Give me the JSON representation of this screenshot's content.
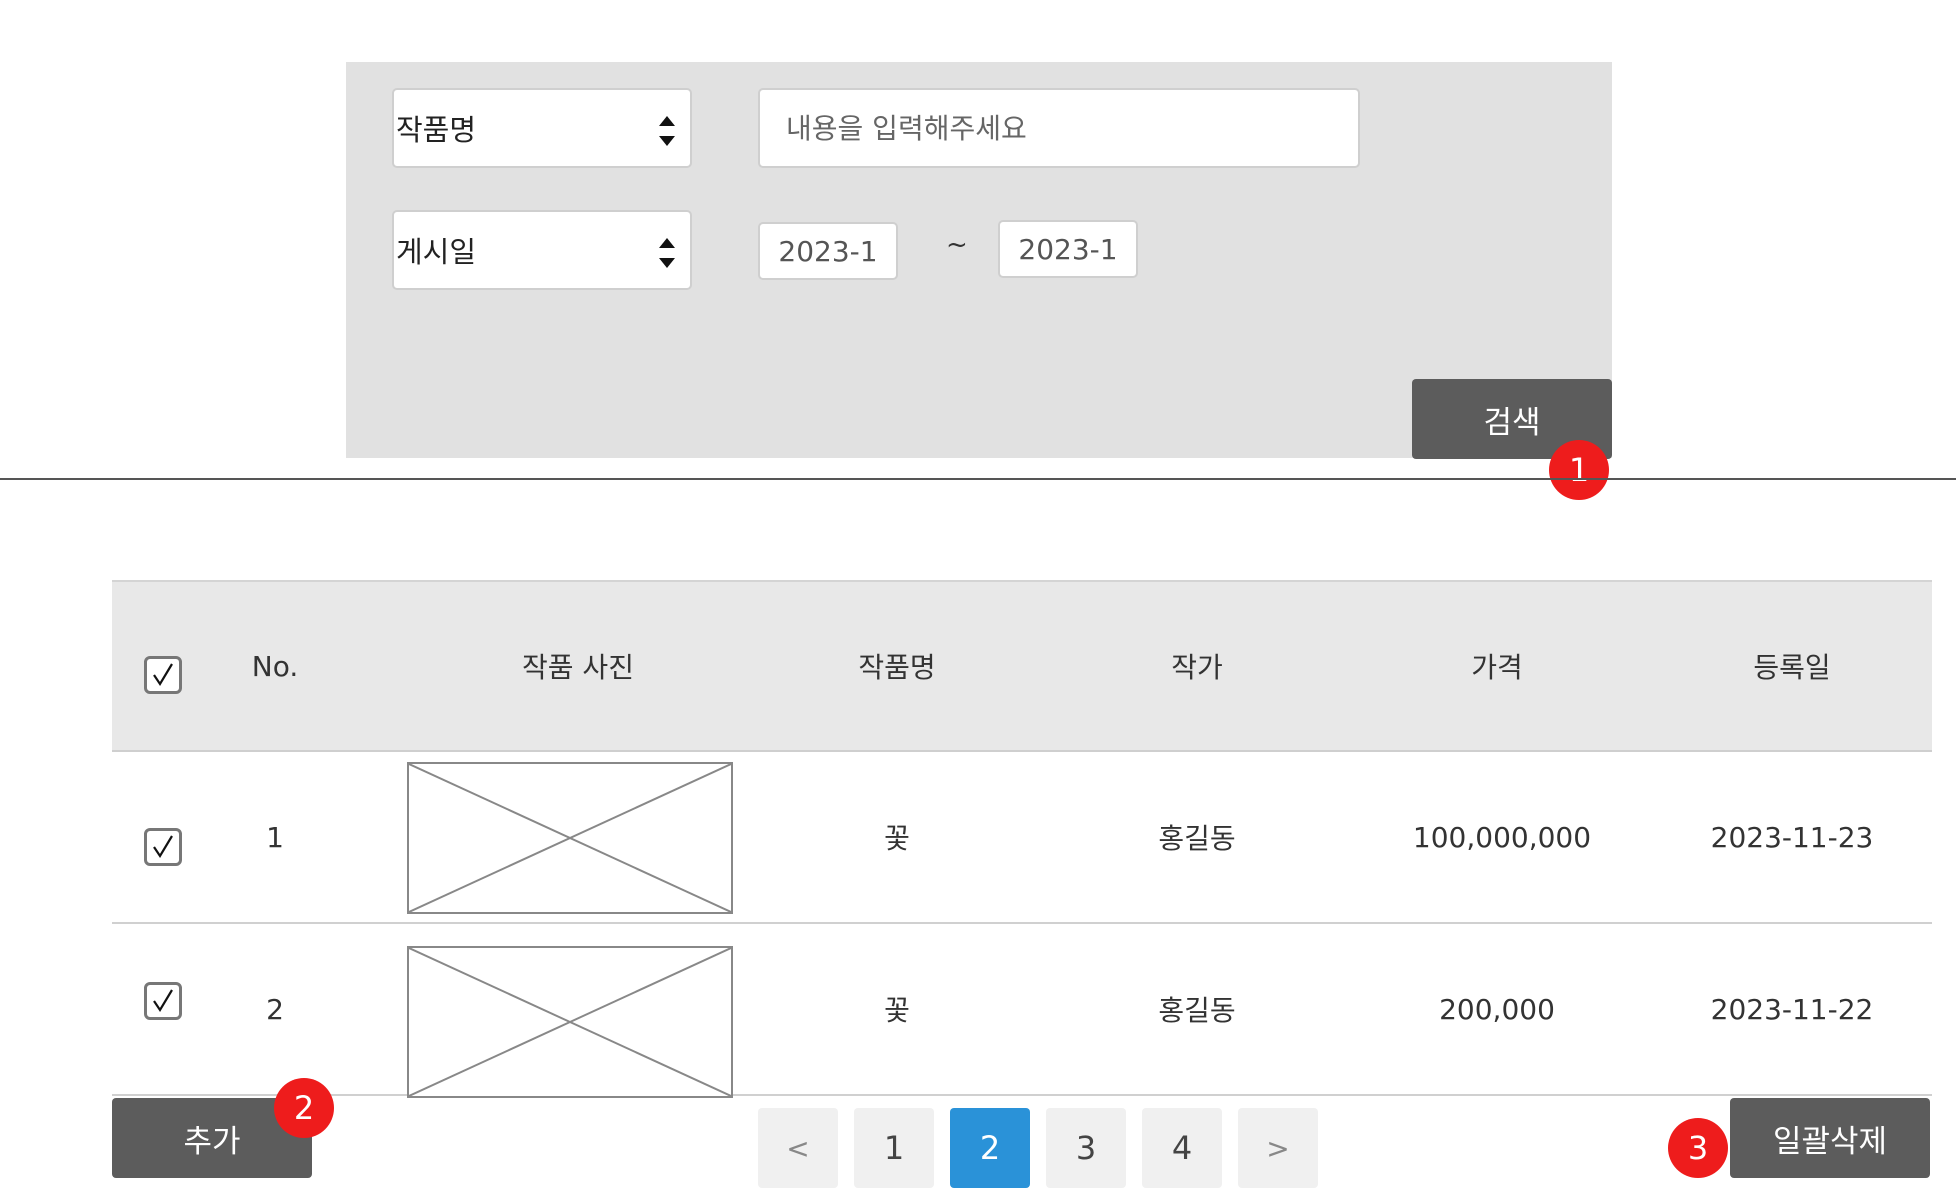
{
  "search": {
    "field_select": "작품명",
    "keyword_placeholder": "내용을 입력해주세요",
    "date_select": "게시일",
    "date_from": "2023-1",
    "date_separator": "~",
    "date_to": "2023-1",
    "search_button": "검색"
  },
  "annotations": [
    "1",
    "2",
    "3"
  ],
  "table": {
    "headers": [
      "No.",
      "작품 사진",
      "작품명",
      "작가",
      "가격",
      "등록일"
    ],
    "rows": [
      {
        "no": "1",
        "title": "꽃",
        "artist": "홍길동",
        "price": "100,000,000",
        "date": "2023-11-23"
      },
      {
        "no": "2",
        "title": "꽃",
        "artist": "홍길동",
        "price": "200,000",
        "date": "2023-11-22"
      }
    ]
  },
  "actions": {
    "add_button": "추가",
    "bulk_delete_button": "일괄삭제"
  },
  "pagination": {
    "prev": "<",
    "pages": [
      "1",
      "2",
      "3",
      "4"
    ],
    "current": "2",
    "next": ">"
  },
  "colors": {
    "panel_bg": "#e1e1e1",
    "button_dark": "#5c5c5c",
    "badge_red": "#ee1c1c",
    "active_page": "#2a92d8"
  }
}
